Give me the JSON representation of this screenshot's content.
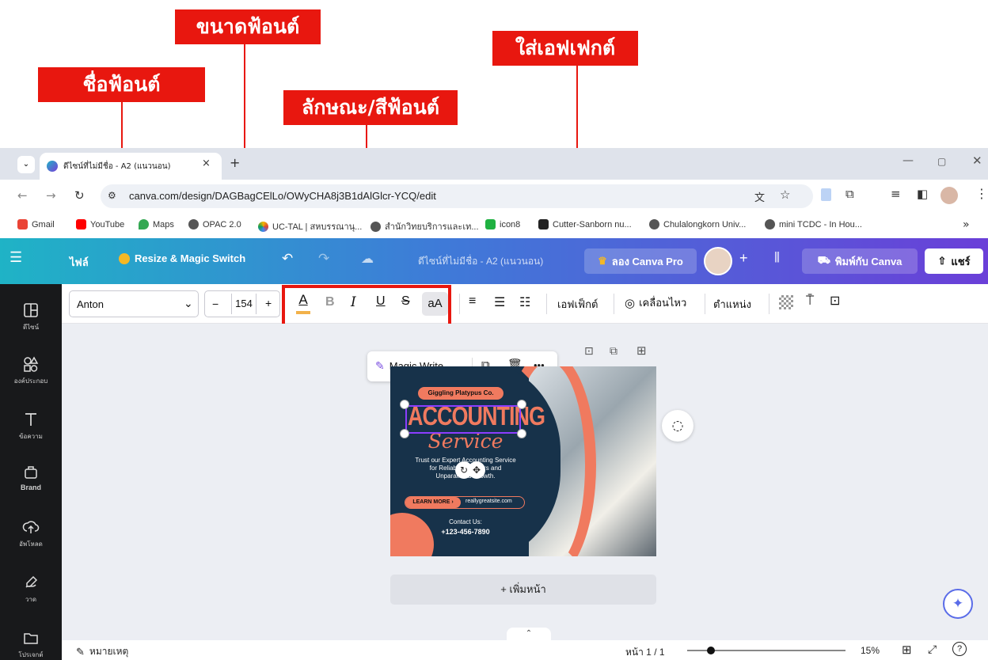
{
  "callouts": {
    "font_name": "ชื่อฟ้อนต์",
    "font_size": "ขนาดฟ้อนต์",
    "font_style": "ลักษณะ/สีฟ้อนต์",
    "effects": "ใส่เอฟเฟกต์"
  },
  "browser": {
    "tab_title": "ดีไซน์ที่ไม่มีชื่อ - A2 (แนวนอน)",
    "url": "canva.com/design/DAGBagCElLo/OWyCHA8j3B1dAlGlcr-YCQ/edit",
    "bookmarks": [
      "Gmail",
      "YouTube",
      "Maps",
      "OPAC 2.0",
      "UC-TAL | สหบรรณานุ...",
      "สำนักวิทยบริการและเท...",
      "icon8",
      "Cutter-Sanborn nu...",
      "Chulalongkorn Univ...",
      "mini TCDC - In Hou..."
    ],
    "more": "»"
  },
  "header": {
    "file": "ไฟล์",
    "resize": "Resize & Magic Switch",
    "doc_title": "ดีไซน์ที่ไม่มีชื่อ - A2 (แนวนอน)",
    "try_pro": "ลอง Canva Pro",
    "print": "พิมพ์กับ Canva",
    "share": "แชร์"
  },
  "toolbar": {
    "font_name": "Anton",
    "font_size": "154",
    "minus": "−",
    "plus": "+",
    "text_color": "A",
    "bold": "B",
    "italic": "I",
    "underline": "U",
    "strike": "S",
    "case": "aA",
    "effects": "เอฟเฟ็กต์",
    "animate": "เคลื่อนไหว",
    "position": "ตำแหน่ง"
  },
  "sidebar": [
    {
      "label": "ดีไซน์",
      "icon": "layout-icon"
    },
    {
      "label": "องค์ประกอบ",
      "icon": "elements-icon"
    },
    {
      "label": "ข้อความ",
      "icon": "text-icon"
    },
    {
      "label": "Brand",
      "icon": "brand-icon"
    },
    {
      "label": "อัพโหลด",
      "icon": "upload-icon"
    },
    {
      "label": "วาด",
      "icon": "draw-icon"
    },
    {
      "label": "โปรเจกต์",
      "icon": "folder-icon"
    }
  ],
  "context_menu": {
    "magic_write": "Magic Write",
    "more": "•••"
  },
  "design": {
    "company": "Giggling Platypus Co.",
    "title": "ACCOUNTING",
    "subtitle": "Service",
    "body": "Trust our Expert Accounting Service for Reliable Numbers and Unparalleled Growth.",
    "learn_more": "LEARN MORE ›",
    "website": "reallygreatsite.com",
    "contact_label": "Contact Us:",
    "phone": "+123-456-7890"
  },
  "add_page": "+ เพิ่มหน้า",
  "status": {
    "notes": "หมายเหตุ",
    "page": "หน้า 1 / 1",
    "zoom": "15%",
    "zoom_level": 0.15
  },
  "colors": {
    "callout_red": "#e8170f",
    "design_navy": "#17324a",
    "design_salmon": "#f07a5f"
  }
}
